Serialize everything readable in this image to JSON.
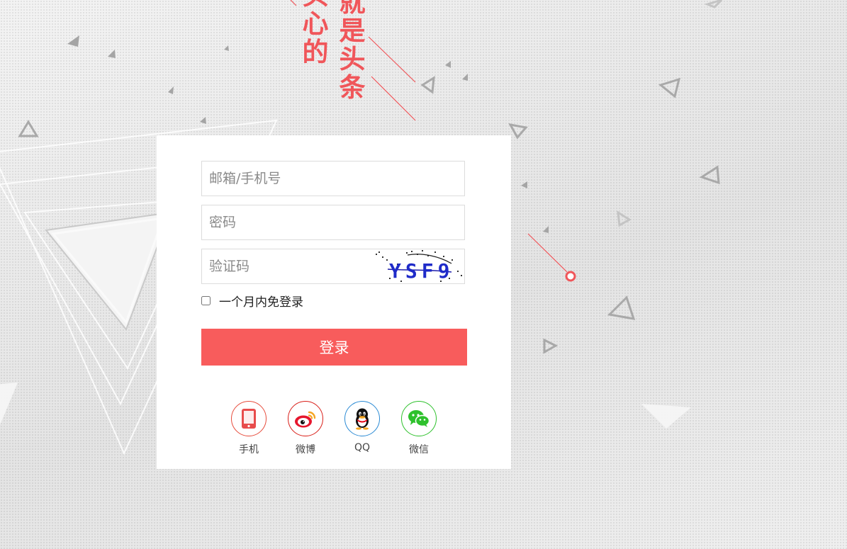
{
  "slogan": {
    "column_left": "头心的",
    "column_right": "就是头条"
  },
  "form": {
    "account_placeholder": "邮箱/手机号",
    "password_placeholder": "密码",
    "captcha_placeholder": "验证码",
    "captcha_text": "YSF9",
    "remember_label": "一个月内免登录",
    "remember_checked": false,
    "login_label": "登录"
  },
  "social": [
    {
      "label": "手机",
      "icon": "phone-icon",
      "color": "#e74c3c"
    },
    {
      "label": "微博",
      "icon": "weibo-icon",
      "color": "#d91e18"
    },
    {
      "label": "QQ",
      "icon": "qq-icon",
      "color": "#2a8ad4"
    },
    {
      "label": "微信",
      "icon": "wechat-icon",
      "color": "#2ec12c"
    }
  ],
  "colors": {
    "accent": "#f85c5c",
    "slogan": "#f0565a"
  }
}
